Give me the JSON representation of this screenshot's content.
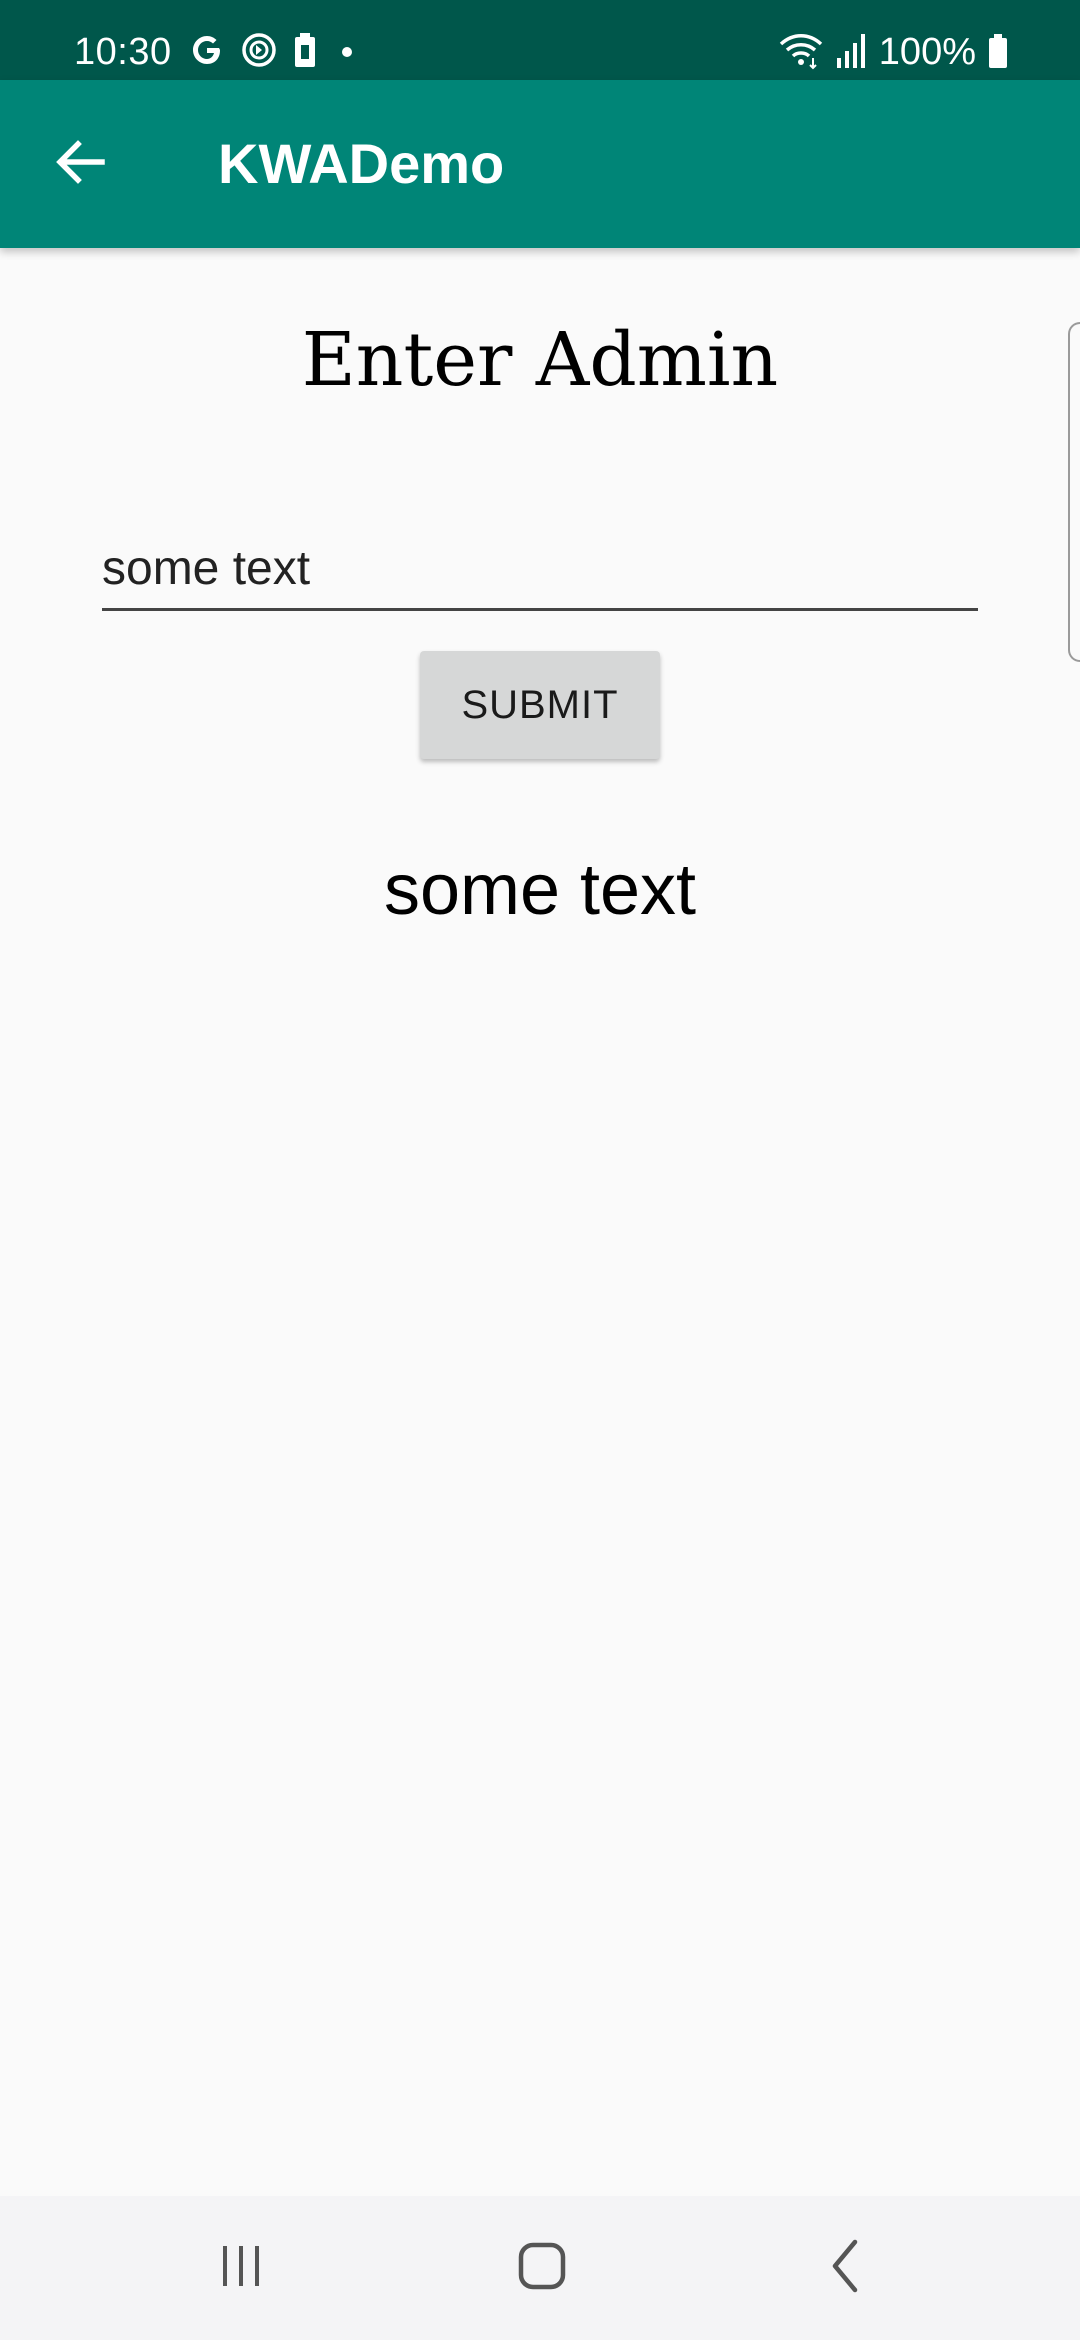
{
  "status_bar": {
    "time": "10:30",
    "battery_text": "100%",
    "icons_left": [
      "google-icon",
      "sync-icon",
      "battery-saver-icon",
      "notification-dot-icon"
    ],
    "icons_right": [
      "wifi-icon",
      "signal-icon",
      "battery-icon"
    ],
    "background": "#00574b"
  },
  "app_bar": {
    "title": "KWADemo",
    "background": "#008577"
  },
  "content": {
    "heading": "Enter Admin",
    "input_value": "some text",
    "submit_label": "SUBMIT",
    "output_text": "some text"
  },
  "nav_bar": {
    "buttons": [
      "recent-apps-icon",
      "home-icon",
      "back-icon"
    ]
  }
}
